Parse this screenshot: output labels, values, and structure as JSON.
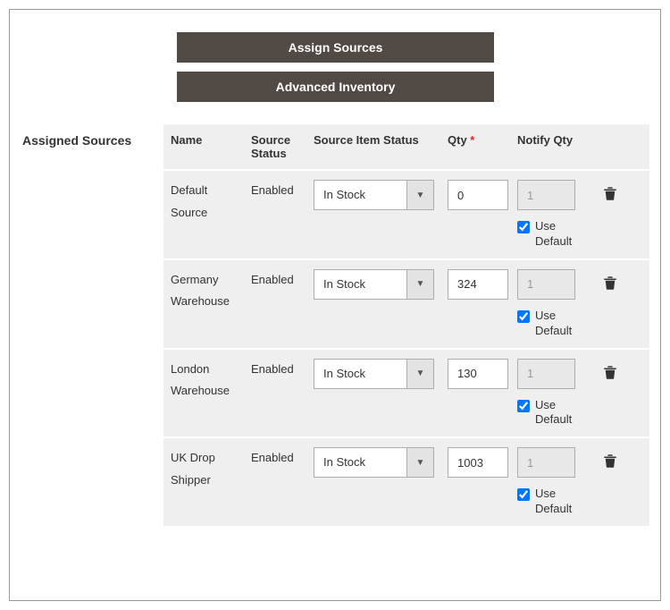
{
  "buttons": {
    "assign_sources": "Assign Sources",
    "advanced_inventory": "Advanced Inventory"
  },
  "panel_label": "Assigned Sources",
  "headers": {
    "name": "Name",
    "source_status": "Source Status",
    "source_item_status": "Source Item Status",
    "qty": "Qty",
    "notify_qty": "Notify Qty"
  },
  "use_default_label": "Use Default",
  "rows": [
    {
      "name": "Default Source",
      "status": "Enabled",
      "item_status": "In Stock",
      "qty": "0",
      "notify_qty": "1",
      "use_default": true
    },
    {
      "name": "Germany Warehouse",
      "status": "Enabled",
      "item_status": "In Stock",
      "qty": "324",
      "notify_qty": "1",
      "use_default": true
    },
    {
      "name": "London Warehouse",
      "status": "Enabled",
      "item_status": "In Stock",
      "qty": "130",
      "notify_qty": "1",
      "use_default": true
    },
    {
      "name": "UK Drop Shipper",
      "status": "Enabled",
      "item_status": "In Stock",
      "qty": "1003",
      "notify_qty": "1",
      "use_default": true
    }
  ]
}
